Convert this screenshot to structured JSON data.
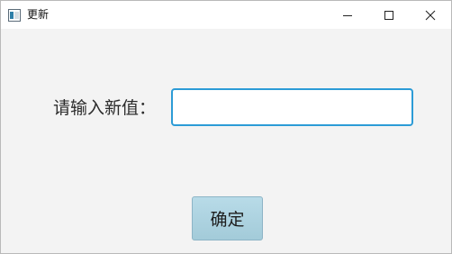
{
  "window": {
    "title": "更新",
    "app_icon": "window-app-icon",
    "controls": {
      "minimize_icon": "minimize-icon",
      "maximize_icon": "maximize-icon",
      "close_icon": "close-icon"
    }
  },
  "form": {
    "label": "请输入新值：",
    "input_value": "",
    "input_placeholder": "",
    "confirm_label": "确定"
  },
  "colors": {
    "window_bg": "#f3f3f3",
    "titlebar_bg": "#ffffff",
    "input_focus_border": "#2c9bd6",
    "button_bg": "#acd3e1"
  }
}
